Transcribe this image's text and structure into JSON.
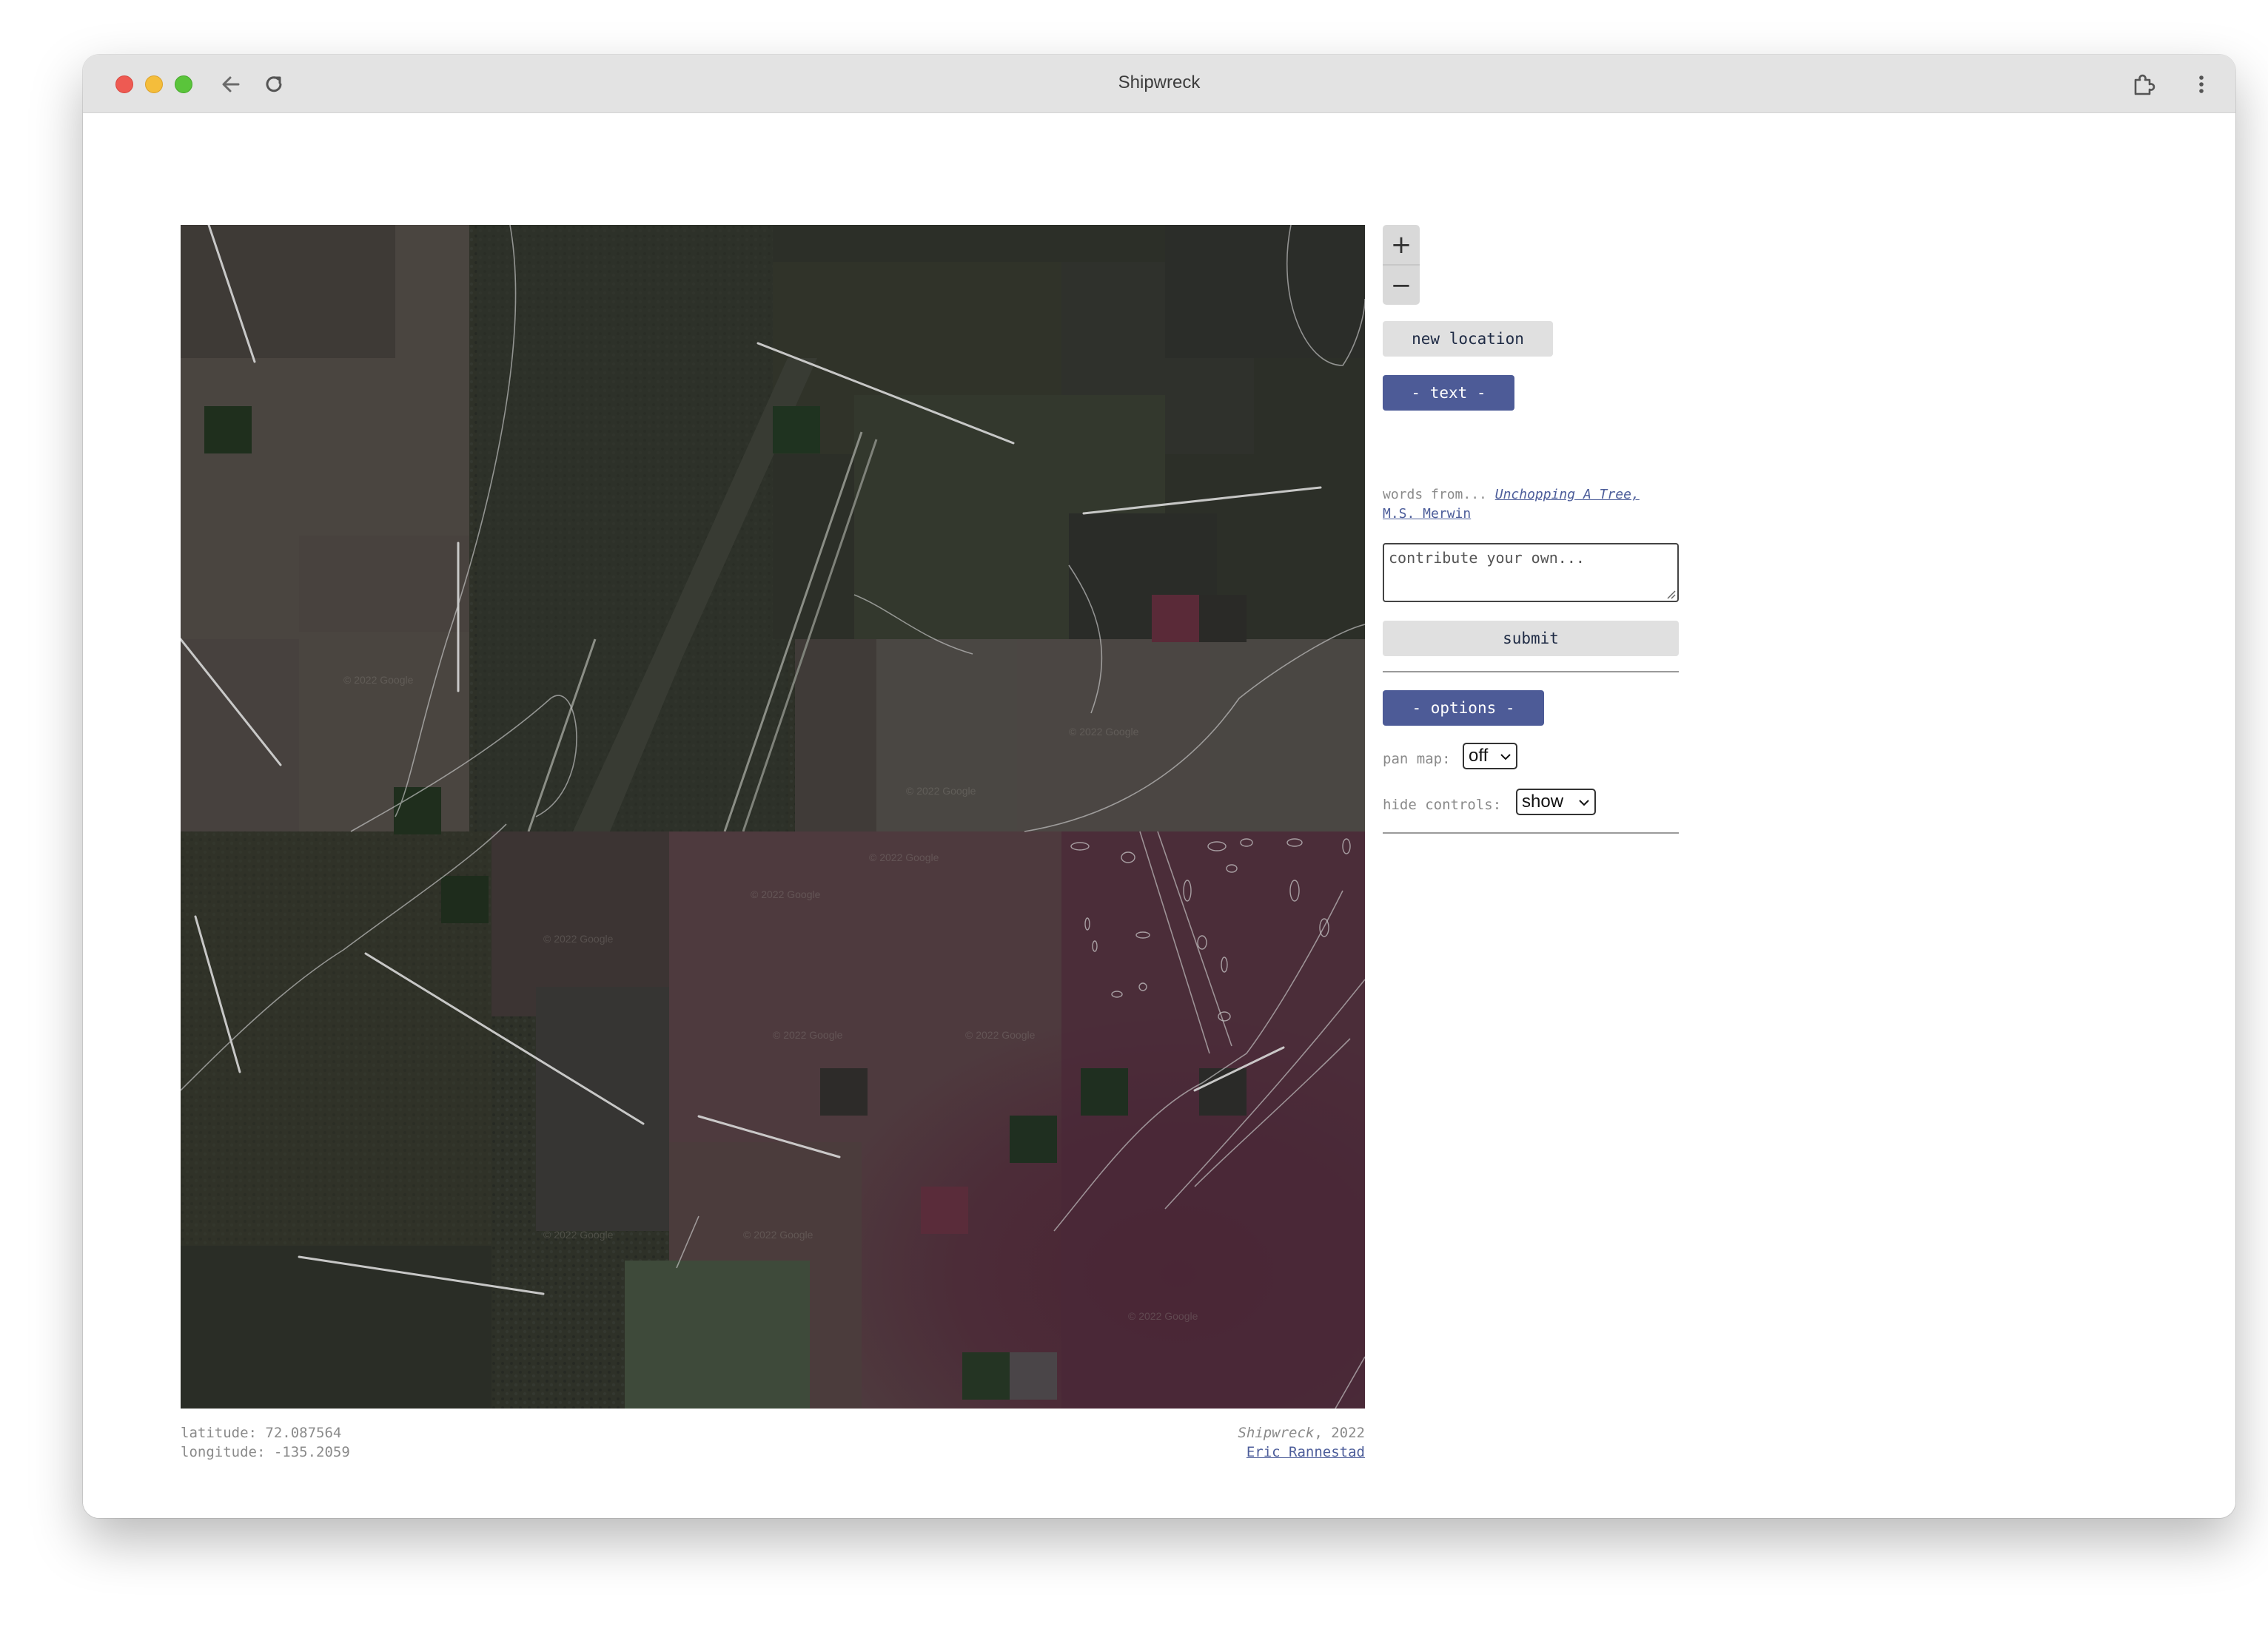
{
  "window": {
    "title": "Shipwreck"
  },
  "icons": {
    "back": "arrow-left-icon",
    "reload": "reload-icon",
    "extensions": "puzzle-icon",
    "menu": "kebab-menu-icon"
  },
  "colors": {
    "accent": "#4d5b97",
    "button_grey": "#e0e0e0",
    "link": "#4c5d9a",
    "muted_text": "#8a8a8a"
  },
  "map": {
    "latitude_text": "latitude: 72.087564",
    "longitude_text": "longitude: -135.2059",
    "watermark": "© 2022 Google"
  },
  "credit": {
    "work_title": "Shipwreck",
    "year": ", 2022",
    "author": "Eric Rannestad"
  },
  "controls": {
    "zoom_in": "+",
    "zoom_out": "−",
    "new_location": "new location",
    "text_toggle": "- text -",
    "words_from": "words from...",
    "source_title": "Unchopping A Tree,",
    "source_author": "M.S. Merwin",
    "contribute_placeholder": "contribute your own...",
    "submit": "submit",
    "options_toggle": "- options -",
    "pan_map_label": "pan map:",
    "pan_map_value": "off",
    "hide_controls_label": "hide controls:",
    "hide_controls_value": "show"
  }
}
